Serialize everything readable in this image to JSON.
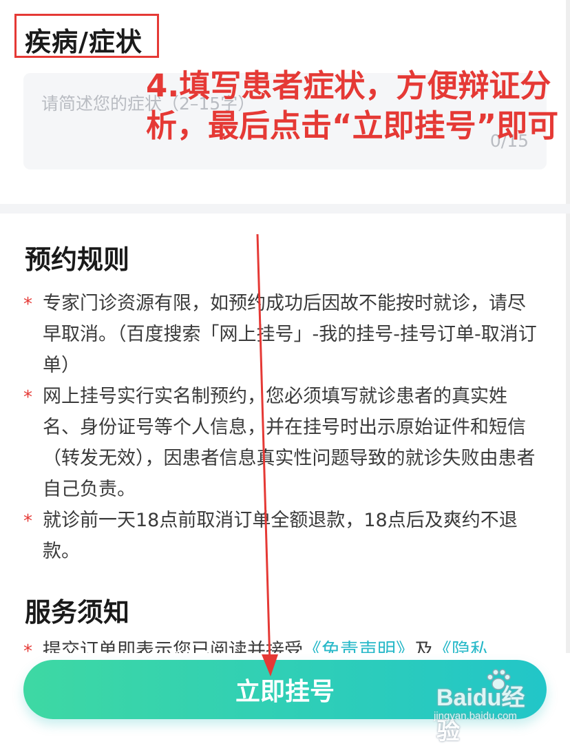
{
  "symptom_section": {
    "label": "疾病/症状",
    "placeholder": "请简述您的症状（2–15字）",
    "counter": "0/15"
  },
  "annotation": {
    "text": "4.填写患者症状，方便辩证分析，最后点击“立即挂号”即可",
    "color": "#e53935"
  },
  "rules_section": {
    "heading": "预约规则",
    "items": [
      "专家门诊资源有限，如预约成功后因故不能按时就诊，请尽早取消。（百度搜索「网上挂号」-我的挂号-挂号订单-取消订单）",
      "网上挂号实行实名制预约，您必须填写就诊患者的真实姓名、身份证号等个人信息，并在挂号时出示原始证件和短信（转发无效），因患者信息真实性问题导致的就诊失败由患者自己负责。",
      "就诊前一天18点前取消订单全额退款，18点后及爽约不退款。"
    ]
  },
  "service_section": {
    "heading": "服务须知",
    "partial_text_prefix": "提交订单即表示您已阅读并接受",
    "link_disclaimer": "《免责声明》",
    "partial_connector": "及",
    "link_privacy": "《隐私"
  },
  "register_button": {
    "label": "立即挂号",
    "colors": [
      "#3ed8a3",
      "#22c6c8"
    ]
  },
  "watermark": {
    "brand": "Baidu经验",
    "url": "jingyan.baidu.com"
  },
  "colors": {
    "accent": "#22c6c8",
    "annotation_red": "#e53935",
    "rule_star": "#e53935",
    "link": "#26b8c8"
  }
}
